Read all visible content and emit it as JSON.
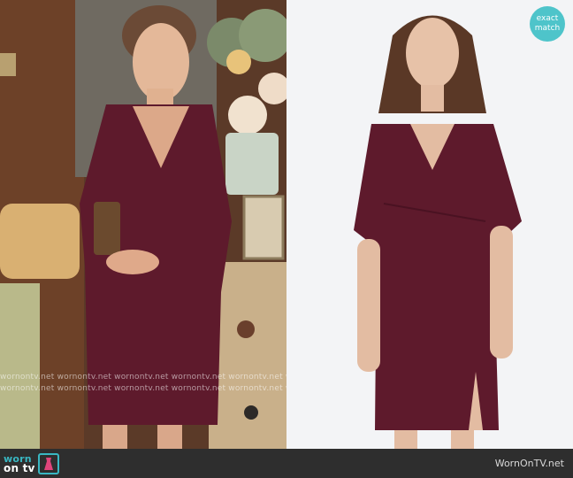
{
  "brand": {
    "logo_line1": "worn",
    "logo_line2": "on tv",
    "site": "WornOnTV.net",
    "watermark_row": "wornontv.net wornontv.net wornontv.net wornontv.net wornontv.net wornontv.net"
  },
  "badge": {
    "line1": "exact",
    "line2": "match"
  },
  "colors": {
    "dress": "#5e1a2c",
    "accent": "#4ec4ca",
    "bar": "#2e2e2e",
    "right_bg": "#f3f4f6"
  }
}
